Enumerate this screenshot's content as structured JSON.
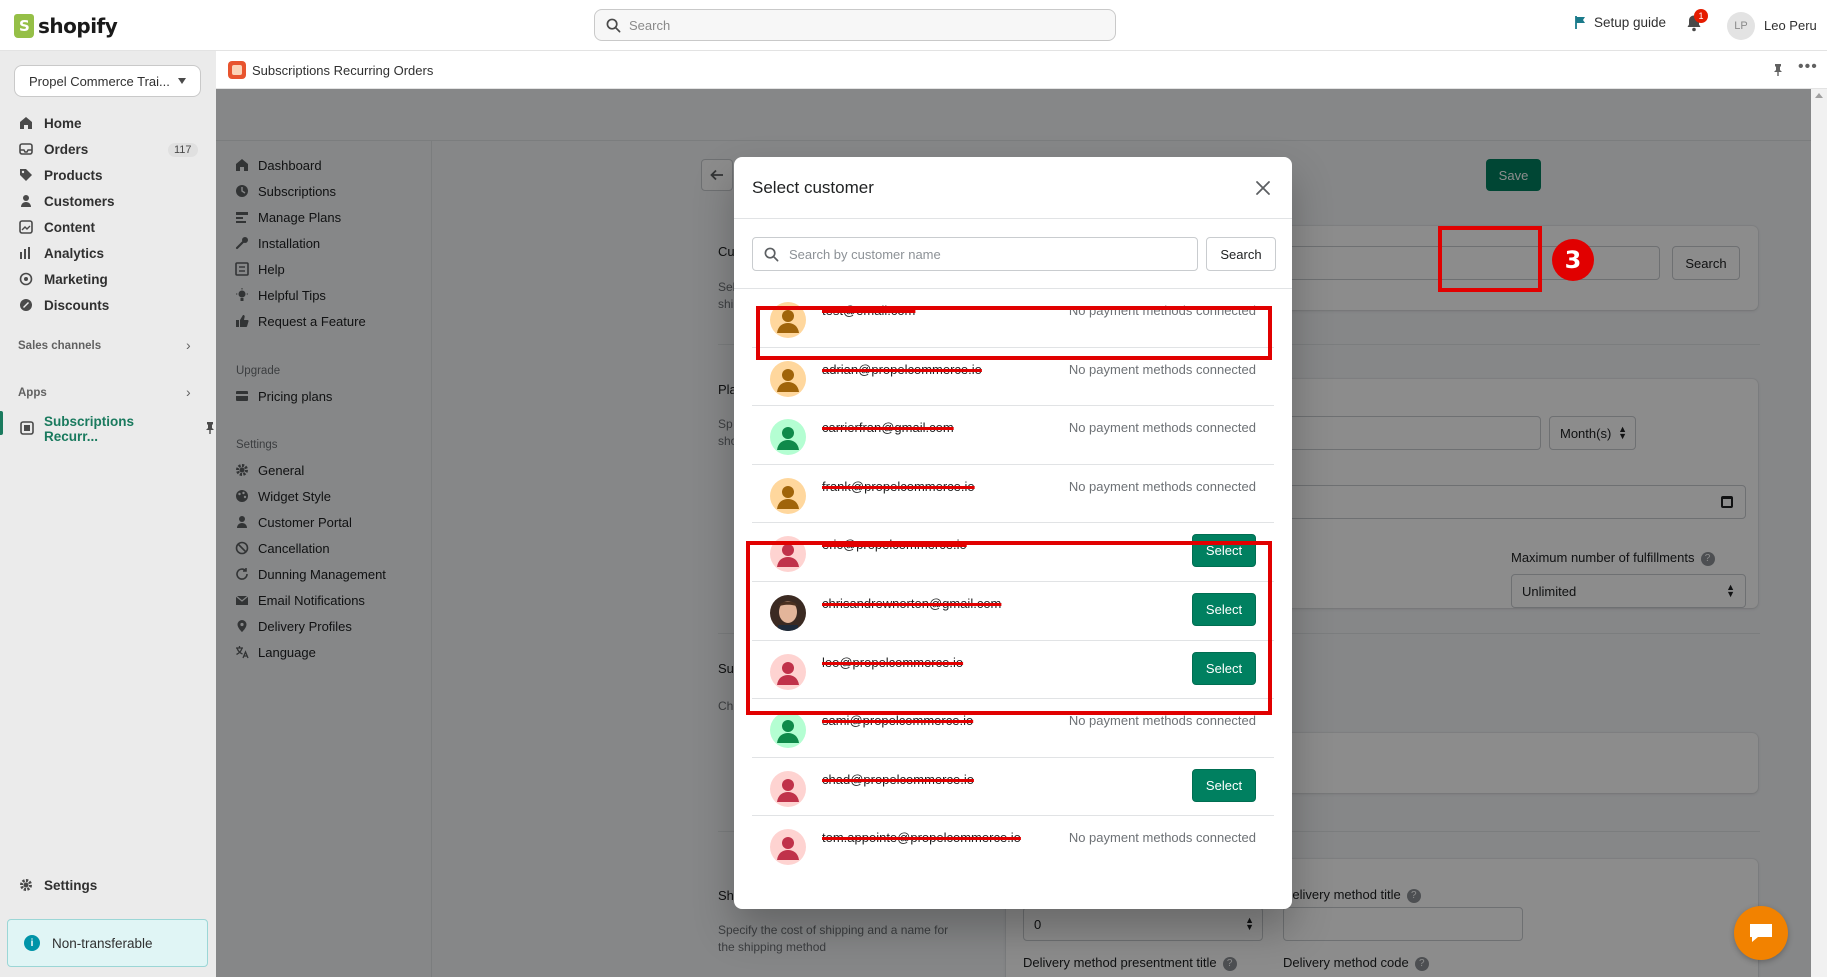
{
  "topbar": {
    "logo_text": "shopify",
    "search_placeholder": "Search",
    "setup_guide": "Setup guide",
    "notification_count": "1",
    "user_initials": "LP",
    "user_name": "Leo Peru"
  },
  "leftnav": {
    "store": "Propel Commerce Trai...",
    "items": [
      {
        "label": "Home",
        "icon": "home-icon"
      },
      {
        "label": "Orders",
        "icon": "orders-icon",
        "badge": "117"
      },
      {
        "label": "Products",
        "icon": "tag-icon"
      },
      {
        "label": "Customers",
        "icon": "person-icon"
      },
      {
        "label": "Content",
        "icon": "content-icon"
      },
      {
        "label": "Analytics",
        "icon": "bar-chart-icon"
      },
      {
        "label": "Marketing",
        "icon": "target-icon"
      },
      {
        "label": "Discounts",
        "icon": "discount-icon"
      }
    ],
    "sales_channels": "Sales channels",
    "apps": "Apps",
    "active_app": "Subscriptions Recurr...",
    "settings": "Settings",
    "non_transferable": "Non-transferable"
  },
  "app_header": {
    "title": "Subscriptions Recurring Orders"
  },
  "app_sidebar": {
    "items": [
      {
        "label": "Dashboard",
        "icon": "home-icon"
      },
      {
        "label": "Subscriptions",
        "icon": "clock-icon"
      },
      {
        "label": "Manage Plans",
        "icon": "plans-icon"
      },
      {
        "label": "Installation",
        "icon": "wrench-icon"
      },
      {
        "label": "Help",
        "icon": "help-icon"
      },
      {
        "label": "Helpful Tips",
        "icon": "bulb-icon"
      },
      {
        "label": "Request a Feature",
        "icon": "thumbs-up-icon"
      }
    ],
    "upgrade_heading": "Upgrade",
    "upgrade_items": [
      {
        "label": "Pricing plans",
        "icon": "pricing-icon"
      }
    ],
    "settings_heading": "Settings",
    "settings_items": [
      {
        "label": "General",
        "icon": "gear-icon"
      },
      {
        "label": "Widget Style",
        "icon": "palette-icon"
      },
      {
        "label": "Customer Portal",
        "icon": "person-icon"
      },
      {
        "label": "Cancellation",
        "icon": "cancel-icon"
      },
      {
        "label": "Dunning Management",
        "icon": "refresh-icon"
      },
      {
        "label": "Email Notifications",
        "icon": "email-icon"
      },
      {
        "label": "Delivery Profiles",
        "icon": "location-icon"
      },
      {
        "label": "Language",
        "icon": "language-icon"
      }
    ]
  },
  "background_form": {
    "save": "Save",
    "customer_heading_fragment": "Cu",
    "customer_desc_fragment": "Sel\nshi",
    "search_button": "Search",
    "plan_heading_fragment": "Pla",
    "plan_desc_fragment": "Sp\nsho",
    "interval_unit": "Month(s)",
    "max_fulfillments_label": "Maximum number of fulfillments",
    "max_fulfillments_value": "Unlimited",
    "sub_heading_fragment": "Su",
    "sub_desc_fragment": "Ch",
    "shipping_heading_fragment": "Sh",
    "shipping_desc": "Specify the cost of shipping and a name for the shipping method",
    "shipping_cost_value": "0",
    "delivery_method_title_label": "Delivery method title",
    "delivery_method_presentment_label": "Delivery method presentment title",
    "delivery_method_code_label": "Delivery method code"
  },
  "annotation": {
    "step_number": "3",
    "color": "#e10000"
  },
  "modal": {
    "title": "Select customer",
    "search_placeholder": "Search by customer name",
    "search_button": "Search",
    "customers": [
      {
        "email": "test@email.com",
        "status": "No payment methods connected",
        "avatar": "orange"
      },
      {
        "email": "adrian@propelcommerce.io",
        "status": "No payment methods connected",
        "avatar": "orange"
      },
      {
        "email": "carrierfran@gmail.com",
        "status": "No payment methods connected",
        "avatar": "green"
      },
      {
        "email": "frank@propelcommerce.io",
        "status": "No payment methods connected",
        "avatar": "orange"
      },
      {
        "email": "eric@propelcommerce.io",
        "action": "Select",
        "avatar": "pink"
      },
      {
        "email": "chrisandrewnorton@gmail.com",
        "action": "Select",
        "avatar": "photo"
      },
      {
        "email": "leo@propelcommerce.io",
        "action": "Select",
        "avatar": "pink"
      },
      {
        "email": "sami@propelcommerce.io",
        "status": "No payment methods connected",
        "avatar": "green"
      },
      {
        "email": "chad@propelcommerce.io",
        "action": "Select",
        "avatar": "pink"
      },
      {
        "email": "tom.appointe@propelcommerce.io",
        "status": "No payment methods connected",
        "avatar": "pink"
      }
    ]
  },
  "colors": {
    "primary_green": "#008060",
    "shopify_green": "#95bf47",
    "chat_orange": "#f28200"
  }
}
